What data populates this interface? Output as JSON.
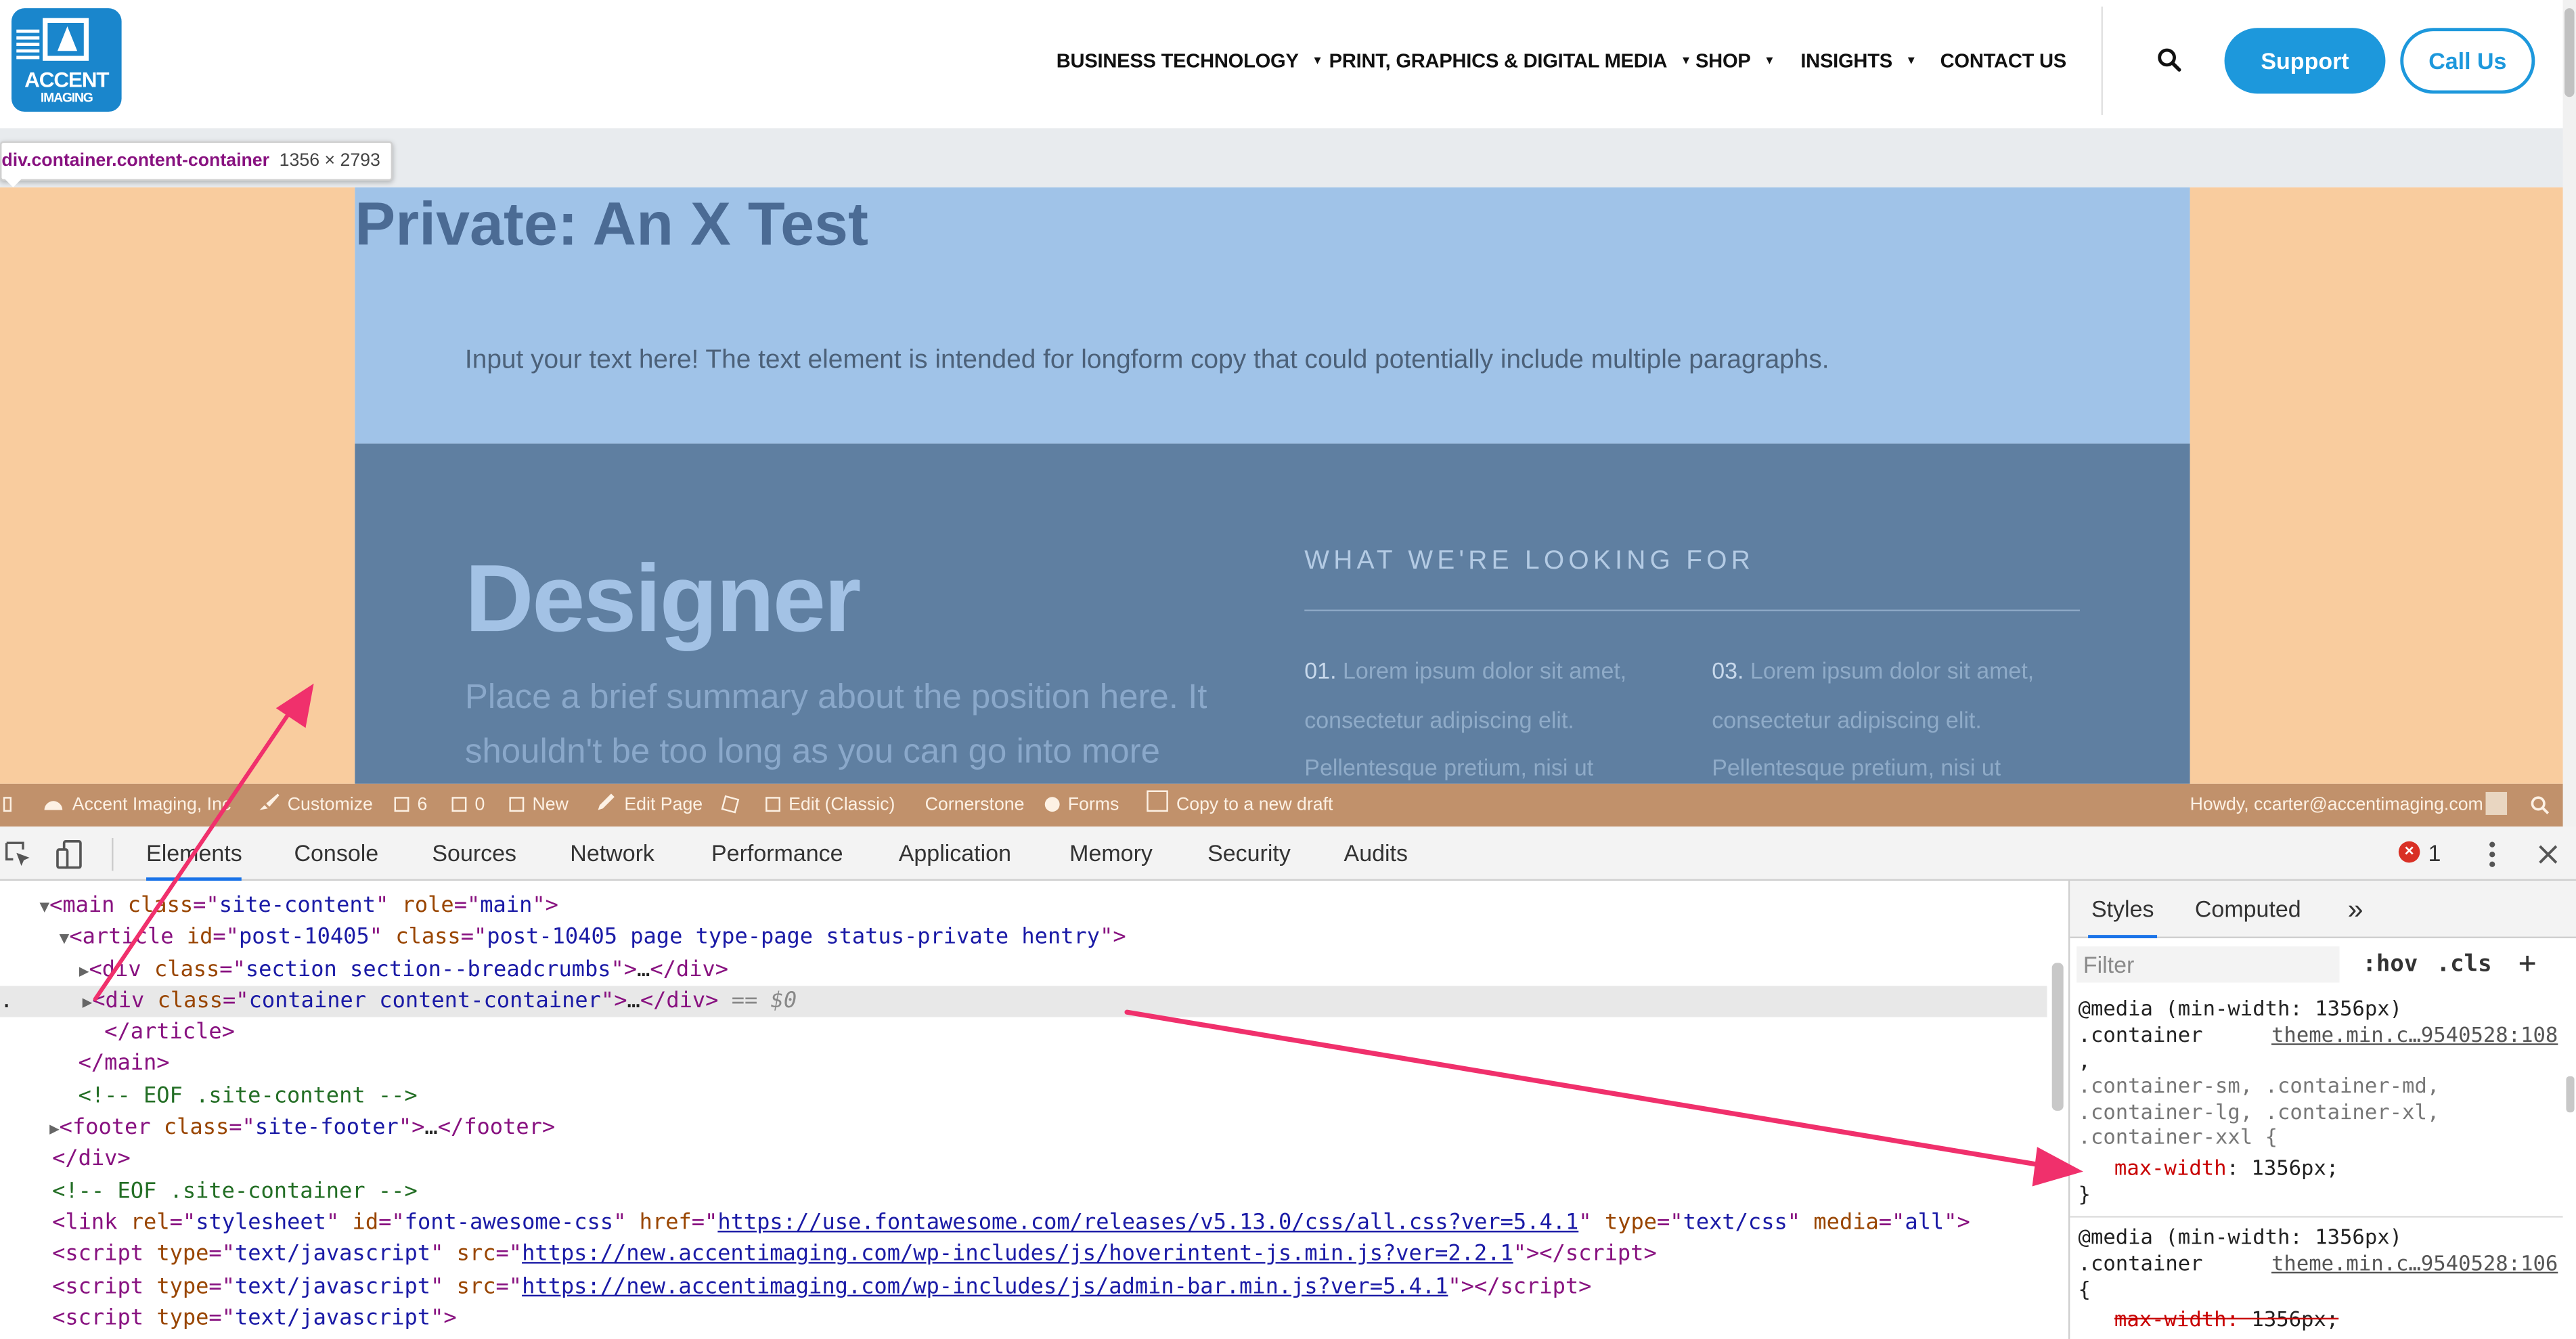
{
  "site": {
    "logo_line1": "ACCENT",
    "logo_line2": "IMAGING",
    "nav": [
      {
        "label": "BUSINESS TECHNOLOGY",
        "caret": "▼"
      },
      {
        "label": "PRINT, GRAPHICS & DIGITAL MEDIA",
        "caret": "▼"
      },
      {
        "label": "SHOP",
        "caret": "▼"
      },
      {
        "label": "INSIGHTS",
        "caret": "▼"
      },
      {
        "label": "CONTACT US"
      }
    ],
    "support_label": "Support",
    "call_label": "Call Us"
  },
  "inspect_tooltip": {
    "selector": "div.container.content-container",
    "size": "1356 × 2793"
  },
  "page": {
    "title": "Private: An X Test",
    "intro": "Input your text here! The text element is intended for longform copy that could potentially include multiple paragraphs.",
    "heading": "Designer",
    "summary": "Place a brief summary about the position here. It shouldn't be too long as you can go into more",
    "looking_for": "WHAT WE'RE LOOKING FOR",
    "items": [
      {
        "num": "01.",
        "line1": "Lorem ipsum dolor sit amet,",
        "line2": "consectetur adipiscing elit.",
        "line3": "Pellentesque pretium, nisi ut"
      },
      {
        "num": "03.",
        "line1": "Lorem ipsum dolor sit amet,",
        "line2": "consectetur adipiscing elit.",
        "line3": "Pellentesque pretium, nisi ut"
      }
    ]
  },
  "admin_bar": {
    "site_name": "Accent Imaging, Inc",
    "customize": "Customize",
    "comments_count": "6",
    "updates_count": "0",
    "new": "New",
    "edit_page": "Edit Page",
    "edit_classic": "Edit (Classic)",
    "cornerstone": "Cornerstone",
    "forms": "Forms",
    "copy_draft": "Copy to a new draft",
    "howdy": "Howdy, ccarter@accentimaging.com"
  },
  "devtools": {
    "tabs": [
      "Elements",
      "Console",
      "Sources",
      "Network",
      "Performance",
      "Application",
      "Memory",
      "Security",
      "Audits"
    ],
    "error_count": "1",
    "dom": {
      "main_class": "site-content",
      "main_role": "main",
      "article_id": "post-10405",
      "article_class": "post-10405 page type-page status-private hentry",
      "crumbs_class": "section section--breadcrumbs",
      "container_class": "container content-container",
      "eq": "== $0",
      "comment_site_content": "<!-- EOF .site-content -->",
      "footer_class": "site-footer",
      "comment_site_container": "<!-- EOF .site-container -->",
      "link_id": "font-awesome-css",
      "link_href": "https://use.fontawesome.com/releases/v5.13.0/css/all.css?ver=5.4.1",
      "link_type": "text/css",
      "link_media": "all",
      "script_type": "text/javascript",
      "script1_src": "https://new.accentimaging.com/wp-includes/js/hoverintent-js.min.js?ver=2.2.1",
      "script2_src": "https://new.accentimaging.com/wp-includes/js/admin-bar.min.js?ver=5.4.1"
    },
    "styles": {
      "tabs": [
        "Styles",
        "Computed"
      ],
      "more": "»",
      "filter_placeholder": "Filter",
      "hov": ":hov",
      ".cls": ".cls",
      "add": "+",
      "rule1": {
        "media": "@media (min-width: 1356px)",
        "selector": ".container",
        "source": "theme.min.c…9540528:108",
        "comma": ",",
        "selectors2": ".container-sm, .container-md,",
        "selectors3": ".container-lg, .container-xl,",
        "selectors4": ".container-xxl {",
        "prop": "max-width",
        "value": "1356px;",
        "close": "}"
      },
      "rule2": {
        "media": "@media (min-width: 1356px)",
        "selector": ".container",
        "source": "theme.min.c…9540528:106",
        "open": "{",
        "prop": "max-width",
        "value": "1356px;"
      }
    }
  },
  "colors": {
    "accent": "#1d98dc",
    "highlight_padding": "#f9cc9e",
    "highlight_content": "#a0c3e8",
    "annotation_arrow": "#f0306c"
  }
}
